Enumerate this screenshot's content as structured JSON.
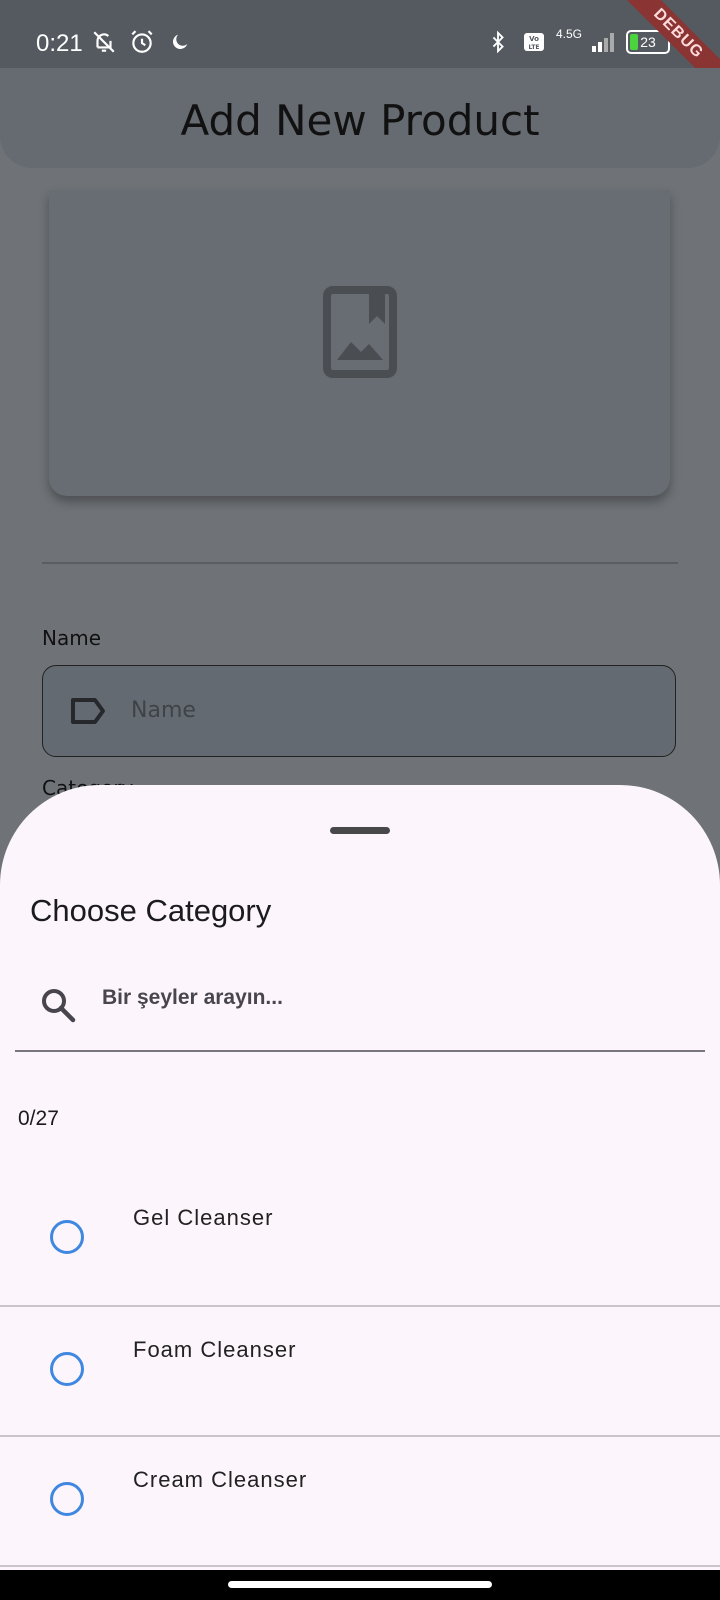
{
  "status_bar": {
    "time": "0:21",
    "left_icons": [
      "bell-off-icon",
      "alarm-icon",
      "moon-icon"
    ],
    "right_icons": [
      "bluetooth-icon",
      "volte-icon",
      "signal-icon"
    ],
    "network": "4.5G",
    "volte": "Vo LTE",
    "battery_level": "23",
    "battery_color": "#4cd43f",
    "debug_banner": "DEBUG"
  },
  "app_bar": {
    "title": "Add New Product"
  },
  "image_card": {
    "icon": "image-placeholder-icon"
  },
  "form": {
    "name_label": "Name",
    "name_placeholder": "Name",
    "name_icon": "tag-icon",
    "category_label": "Category"
  },
  "sheet": {
    "title": "Choose Category",
    "search_placeholder": "Bir şeyler arayın...",
    "selection_count": "0/27",
    "accent_color": "#3f87e0",
    "items": [
      {
        "label": "Gel Cleanser",
        "selected": false
      },
      {
        "label": "Foam Cleanser",
        "selected": false
      },
      {
        "label": "Cream Cleanser",
        "selected": false
      }
    ]
  }
}
